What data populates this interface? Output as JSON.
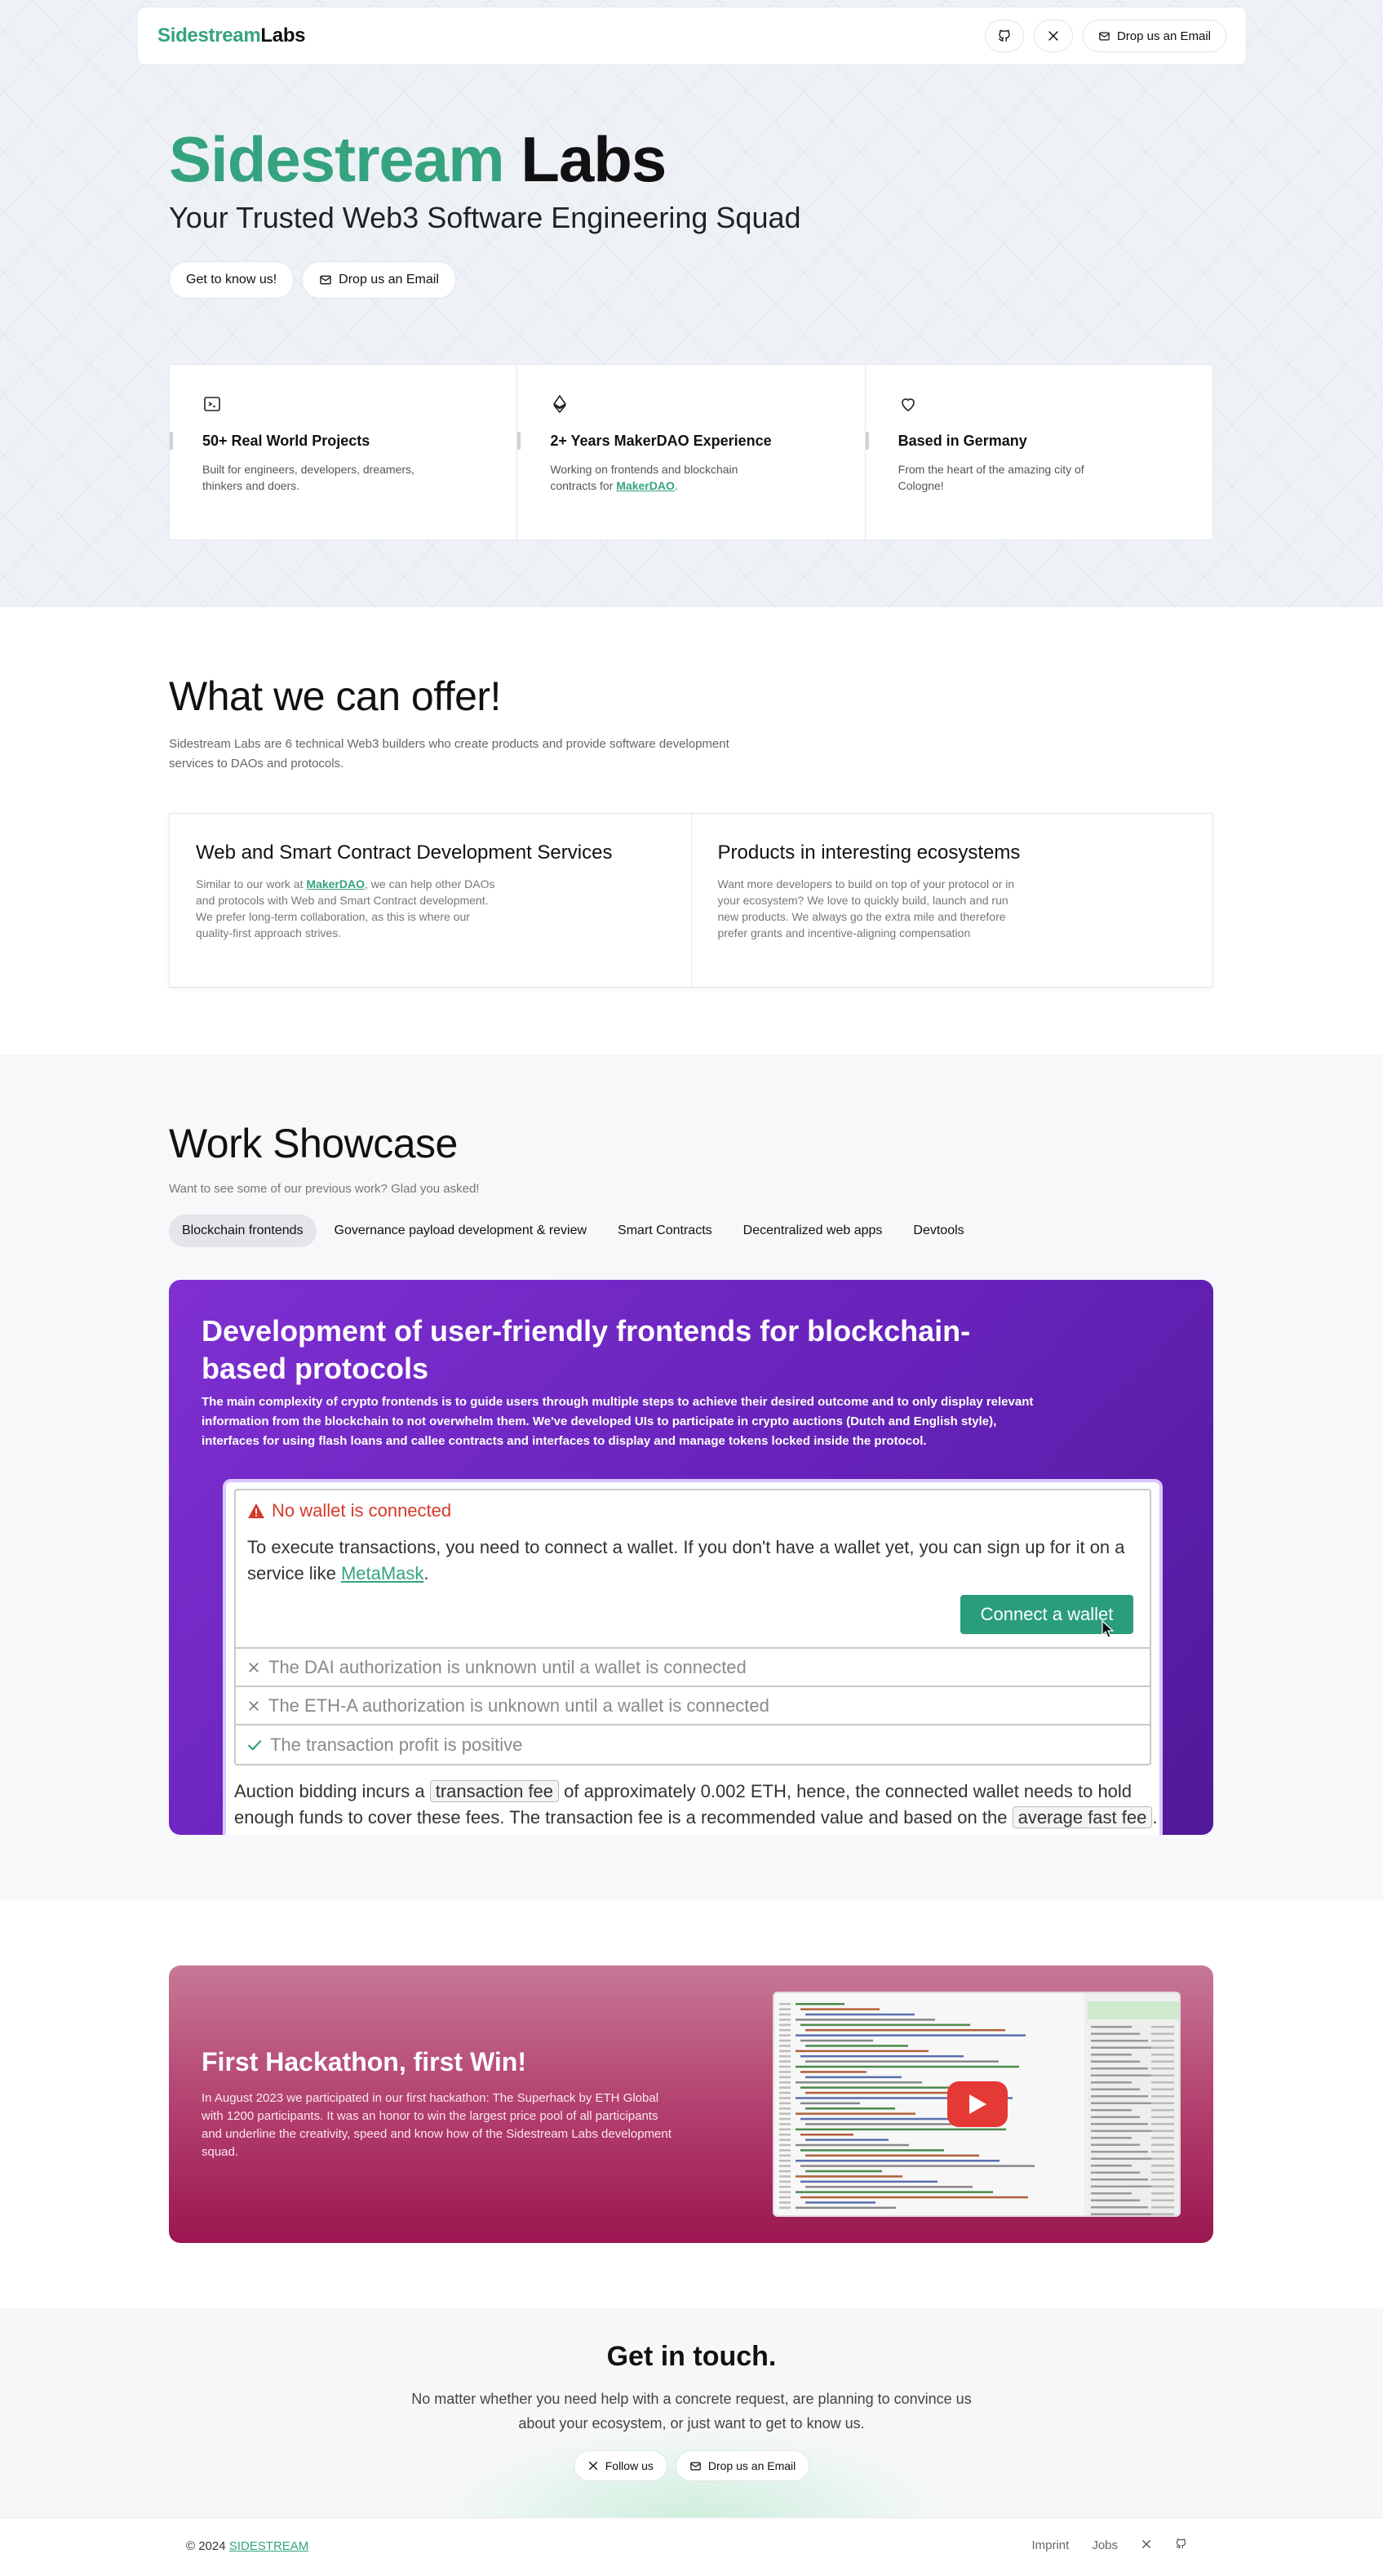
{
  "nav": {
    "logo_part1": "Sidestream",
    "logo_part2": "Labs",
    "email_label": "Drop us an Email"
  },
  "hero": {
    "title_part1": "Sidestream",
    "title_part2": "Labs",
    "subtitle": "Your Trusted Web3 Software Engineering Squad",
    "btn_know": "Get to know us!",
    "btn_email": "Drop us an Email",
    "features": [
      {
        "title": "50+ Real World Projects",
        "text": "Built for engineers, developers, dreamers, thinkers and doers.",
        "link": ""
      },
      {
        "title": "2+ Years MakerDAO Experience",
        "text": "Working on frontends and blockchain contracts for",
        "link": "MakerDAO"
      },
      {
        "title": "Based in Germany",
        "text": "From the heart of the amazing city of Cologne!",
        "link": ""
      }
    ]
  },
  "offer": {
    "title": "What we can offer!",
    "lead": "Sidestream Labs are 6 technical Web3 builders who create products and provide software development services to DAOs and protocols.",
    "cards": [
      {
        "title": "Web and Smart Contract Development Services",
        "text_before": "Similar to our work at",
        "link": "MakerDAO",
        "text_after": ", we can help other DAOs and protocols with Web and Smart Contract development. We prefer long-term collaboration, as this is where our quality-first approach strives."
      },
      {
        "title": "Products in interesting ecosystems",
        "text": "Want more developers to build on top of your protocol or in your ecosystem? We love to quickly build, launch and run new products. We always go the extra mile and therefore prefer grants and incentive-aligning compensation"
      }
    ]
  },
  "showcase": {
    "title": "Work Showcase",
    "lead": "Want to see some of our previous work? Glad you asked!",
    "tabs": [
      "Blockchain frontends",
      "Governance payload development & review",
      "Smart Contracts",
      "Decentralized web apps",
      "Devtools"
    ],
    "card_title": "Development of user-friendly frontends for blockchain-based protocols",
    "card_desc": "The main complexity of crypto frontends is to guide users through multiple steps to achieve their desired outcome and to only display relevant information from the blockchain to not overwhelm them. We've developed UIs to participate in crypto auctions (Dutch and English style), interfaces for using flash loans and callee contracts and interfaces to display and manage tokens locked inside the protocol.",
    "shot": {
      "alert_title": "No wallet is connected",
      "alert_text": "To execute transactions, you need to connect a wallet. If you don't have a wallet yet, you can sign up for it on a service like",
      "alert_link": "MetaMask",
      "connect_label": "Connect a wallet",
      "checks": [
        {
          "text": "The DAI authorization is unknown until a wallet is connected",
          "icon": "x-icon"
        },
        {
          "text": "The ETH-A authorization is unknown until a wallet is connected",
          "icon": "x-icon"
        },
        {
          "text": "The transaction profit is positive",
          "icon": "check-icon"
        }
      ],
      "foot_1": "Auction bidding incurs a",
      "foot_code1": "transaction fee",
      "foot_2": "of approximately 0.002 ETH, hence, the connected wallet needs to hold enough funds to cover these fees. The transaction fee is a recommended value and based on the",
      "foot_code2": "average fast fee",
      "foot_3": "."
    }
  },
  "hackathon": {
    "title": "First Hackathon, first Win!",
    "text": "In August 2023 we participated in our first hackathon: The Superhack by ETH Global with 1200 participants. It was an honor to win the largest price pool of all participants and underline the creativity, speed and know how of the Sidestream Labs development squad."
  },
  "contact": {
    "title": "Get in touch.",
    "text": "No matter whether you need help with a concrete request, are planning to convince us about your ecosystem, or just want to get to know us.",
    "follow_label": "Follow us",
    "email_label": "Drop us an Email"
  },
  "footer": {
    "copyright": "© 2024",
    "brand": "SIDESTREAM",
    "imprint": "Imprint",
    "jobs": "Jobs"
  },
  "colors": {
    "brand_green": "#35a37e",
    "showcase_purple": "#6522b8",
    "hackathon_pink": "#b3416f"
  }
}
